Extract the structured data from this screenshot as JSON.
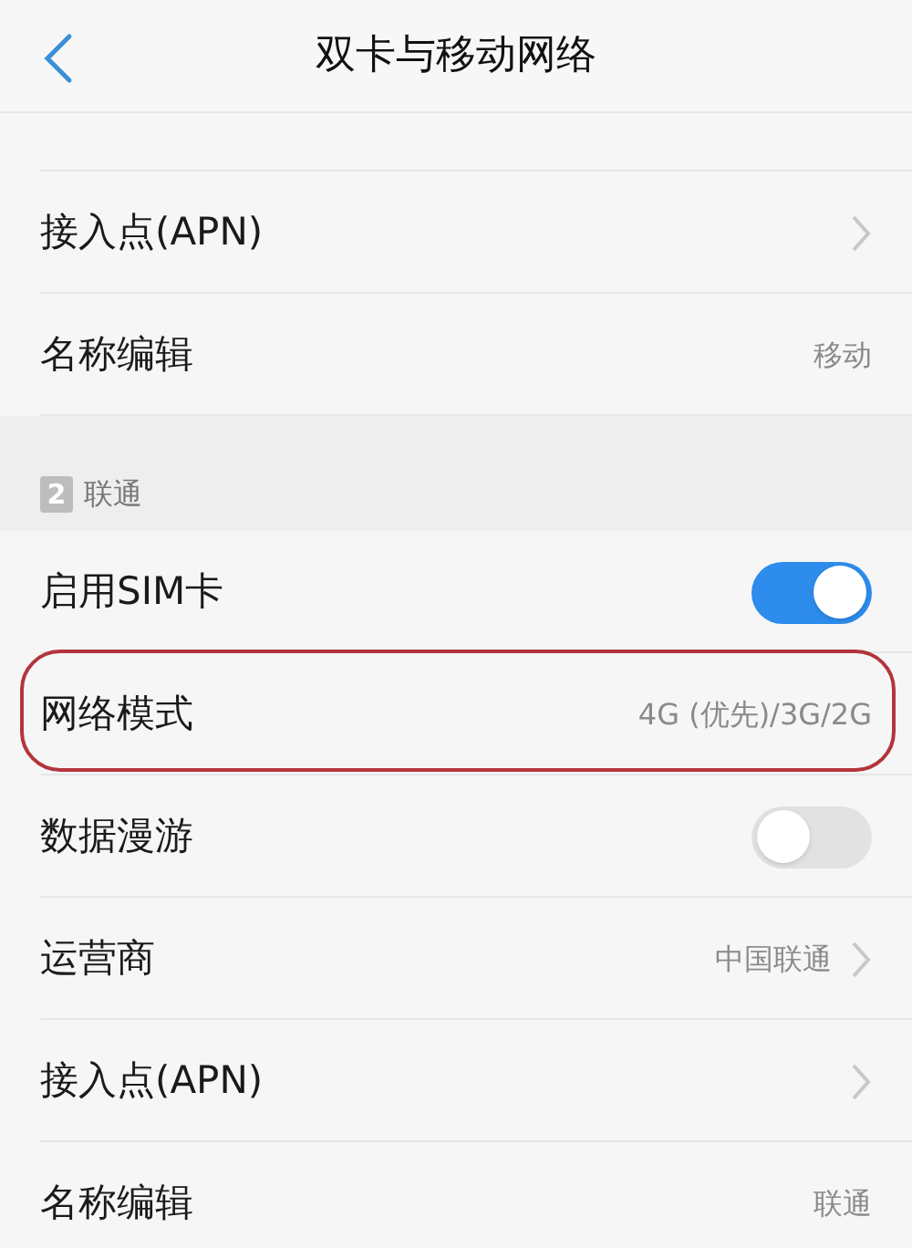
{
  "title": "双卡与移动网络",
  "sections": [
    {
      "rows": [
        {
          "kind": "nav",
          "label": "接入点(APN)",
          "chevron": true,
          "highlighted": false
        },
        {
          "kind": "nav",
          "label": "名称编辑",
          "value": "移动",
          "chevron": false,
          "highlighted": false
        }
      ]
    },
    {
      "badge": "2",
      "label": "联通",
      "rows": [
        {
          "kind": "toggle",
          "label": "启用SIM卡",
          "on": true,
          "highlighted": false
        },
        {
          "kind": "nav",
          "label": "网络模式",
          "value": "4G (优先)/3G/2G",
          "chevron": false,
          "highlighted": true
        },
        {
          "kind": "toggle",
          "label": "数据漫游",
          "on": false,
          "highlighted": false
        },
        {
          "kind": "nav",
          "label": "运营商",
          "value": "中国联通",
          "chevron": true,
          "highlighted": false
        },
        {
          "kind": "nav",
          "label": "接入点(APN)",
          "chevron": true,
          "highlighted": false
        },
        {
          "kind": "nav",
          "label": "名称编辑",
          "value": "联通",
          "chevron": false,
          "highlighted": false
        }
      ]
    }
  ]
}
